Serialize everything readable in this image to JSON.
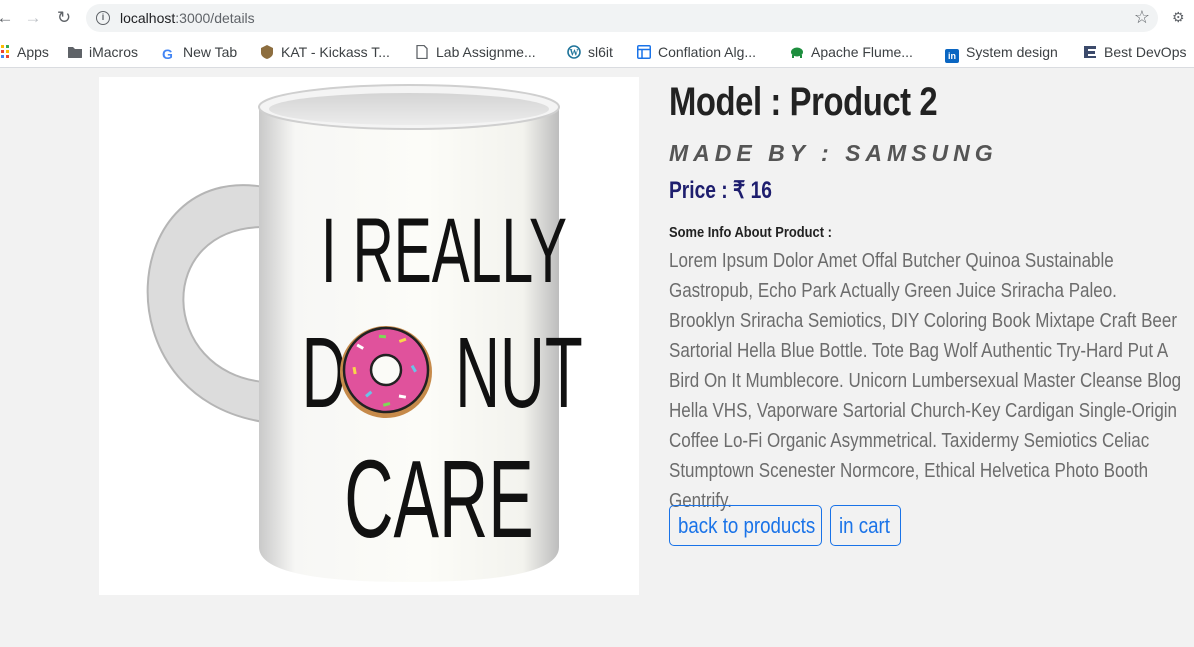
{
  "browser": {
    "url_host": "localhost",
    "url_path": ":3000/details",
    "bookmarks": [
      {
        "label": "Apps",
        "icon": "apps-grid-icon",
        "color": "#ea4335"
      },
      {
        "label": "iMacros",
        "icon": "folder-icon",
        "color": "#5f6368"
      },
      {
        "label": "New Tab",
        "icon": "google-icon",
        "color": "#4285f4"
      },
      {
        "label": "KAT - Kickass T...",
        "icon": "kat-shield-icon",
        "color": "#8d6e3f"
      },
      {
        "label": "Lab Assignme...",
        "icon": "document-icon",
        "color": "#5f6368"
      },
      {
        "label": "sl6it",
        "icon": "wordpress-icon",
        "color": "#21759b"
      },
      {
        "label": "Conflation Alg...",
        "icon": "layout-icon",
        "color": "#1a73e8"
      },
      {
        "label": "Apache Flume...",
        "icon": "flume-icon",
        "color": "#1e8e3e"
      },
      {
        "label": "System design",
        "icon": "linkedin-icon",
        "color": "#0a66c2"
      },
      {
        "label": "Best DevOps",
        "icon": "devops-icon",
        "color": "#3c4a6b"
      }
    ]
  },
  "product": {
    "title": "Model : Product 2",
    "maker": "made by : samsung",
    "price": "Price : ₹ 16",
    "info_heading": "Some Info About Product :",
    "description": "Lorem Ipsum Dolor Amet Offal Butcher Quinoa Sustainable Gastropub, Echo Park Actually Green Juice Sriracha Paleo. Brooklyn Sriracha Semiotics, DIY Coloring Book Mixtape Craft Beer Sartorial Hella Blue Bottle. Tote Bag Wolf Authentic Try-Hard Put A Bird On It Mumblecore. Unicorn Lumbersexual Master Cleanse Blog Hella VHS, Vaporware Sartorial Church-Key Cardigan Single-Origin Coffee Lo-Fi Organic Asymmetrical. Taxidermy Semiotics Celiac Stumptown Scenester Normcore, Ethical Helvetica Photo Booth Gentrify.",
    "image_text": [
      "I REALLY",
      "D",
      "NUT",
      "CARE"
    ]
  },
  "actions": {
    "back_label": "back to products",
    "cart_label": "in cart"
  },
  "colors": {
    "accent": "#1a73e8",
    "price": "#1e1e6e",
    "donut_icing": "#e0529c"
  }
}
